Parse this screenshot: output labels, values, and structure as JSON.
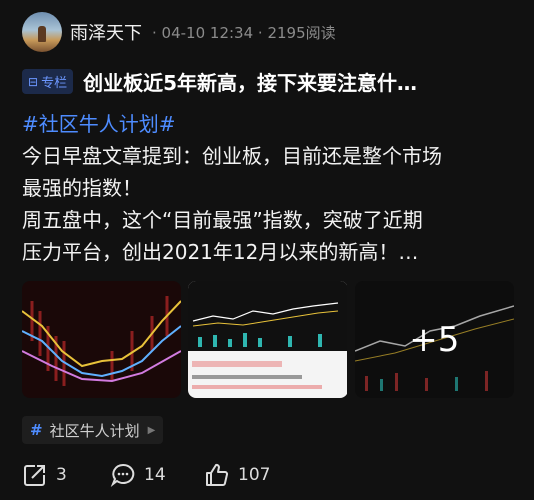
{
  "post": {
    "author": "雨泽天下",
    "time": "04-10 12:34",
    "views": "2195阅读",
    "tag": "专栏",
    "title": "创业板近5年新高，接下来要注意什…",
    "hashtag": "#社区牛人计划#",
    "body_lines": [
      "今日早盘文章提到：创业板，目前还是整个市场",
      "最强的指数！",
      "周五盘中，这个“目前最强”指数，突破了近期",
      "压力平台，创出2021年12月以来的新高！…"
    ],
    "more_images": "+5",
    "topic": "社区牛人计划",
    "actions": {
      "share": "3",
      "comments": "14",
      "likes": "107"
    }
  },
  "icons": [
    "avatar",
    "column-tag-icon",
    "hashtag-icon",
    "chevron-right-icon",
    "share-icon",
    "comment-icon",
    "like-icon"
  ],
  "colors": {
    "background": "#111111",
    "accent": "#4e8cff",
    "tag_bg": "#1c2a4a"
  }
}
